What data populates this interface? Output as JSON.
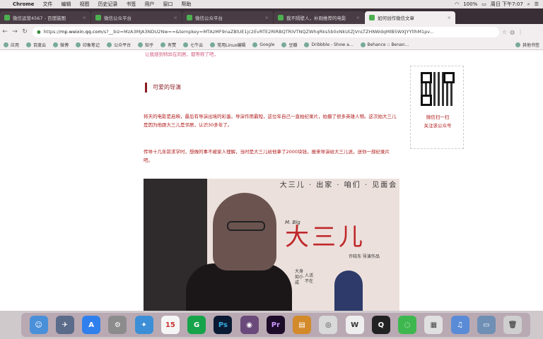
{
  "menubar": {
    "app_name": "Chrome",
    "items": [
      "文件",
      "编辑",
      "视图",
      "历史记录",
      "书签",
      "用户",
      "窗口",
      "帮助"
    ],
    "status": "100%",
    "clock": "周日 下午7:07"
  },
  "tabs": [
    {
      "label": "微信运营4567 - 百度脑图",
      "active": false
    },
    {
      "label": "微信公众平台",
      "active": false
    },
    {
      "label": "微信公众平台",
      "active": false
    },
    {
      "label": "我不隔壁人，补刚推荐的电影",
      "active": false
    },
    {
      "label": "如何创作微信文章",
      "active": true
    }
  ],
  "address": {
    "protocol": "https://",
    "host": "mp.weixin.qq.com",
    "path": "/s?__biz=MzA3MjA3NDU2Nw==&tempkey=MTAzMF9naZBlUE1jc2EvRTE2RlRBQTRIVTNQZWhqRks5b0xNkUtZjVnLTZHNWdqMlB5WXJYYllhM1pv..."
  },
  "bookmarks": [
    "应用",
    "百度云",
    "微博",
    "印象笔记",
    "公众平台",
    "知乎",
    "有赞",
    "七牛云",
    "常用Linux编辑",
    "Google",
    "豆瓣",
    "Dribbble - Show a...",
    "Behance :: Benan...",
    "其他书签"
  ],
  "article": {
    "top_fade": "让我感到特异在同居，都等称了吧，",
    "section_title": "可爱的导演",
    "para1": "将天的电影是启映，最后有导演出境的彩蛋。导演作用最短，这位年自己一直拍纪录片，拍摄了很多英雄人物。这次拍大三儿是因为他跟大三儿是邻居，认识30多年了。",
    "para2": "传导十几年前求学时，想做的事不被家人理解，当时是大三儿给他拿了2000块钱，报来导演给大三儿说，送你一部纪录片吧。",
    "poster_top": "大三儿 · 出家 · 咱们 · 见面会",
    "poster_title": "大三儿",
    "poster_small": "M. Big",
    "poster_sub": "许晓东 导演作品",
    "vtext1": "大身如小成",
    "vtext2": "人活不在"
  },
  "sidebar": {
    "qr_line1": "微信扫一扫",
    "qr_line2": "关注该公众号"
  },
  "dock": [
    "Finder",
    "Launchpad",
    "App Store",
    "System",
    "Safari",
    "Calendar 15",
    "Grammarly",
    "Photoshop",
    "Preview",
    "Premiere",
    "Keynote",
    "Chrome",
    "WPS",
    "QQ",
    "WeChat",
    "Docker",
    "Music",
    "Folder",
    "Trash"
  ]
}
